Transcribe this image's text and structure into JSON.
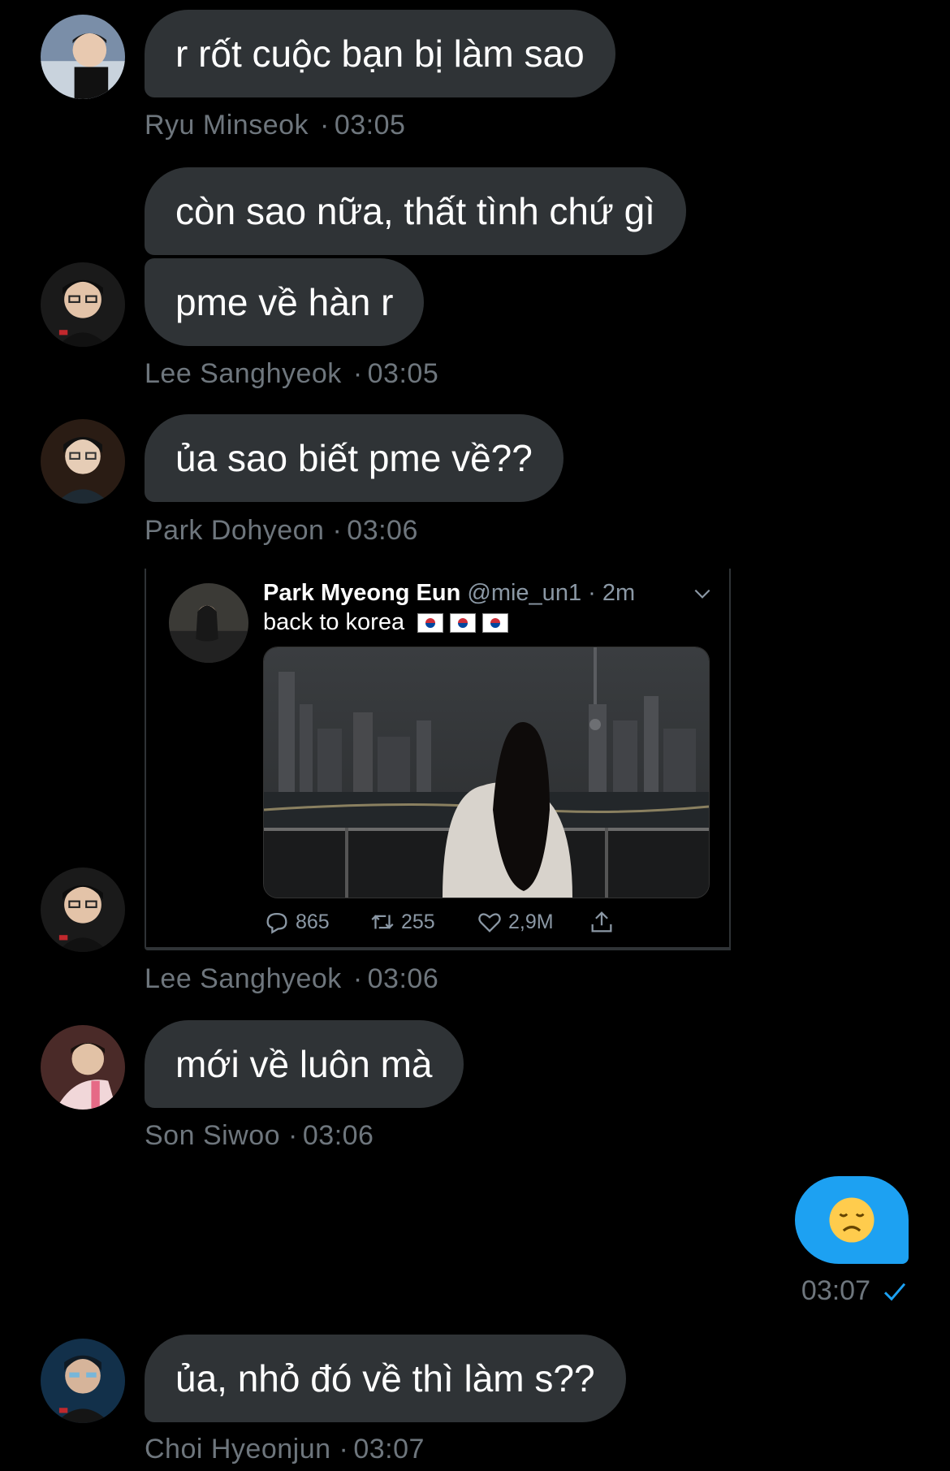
{
  "messages": [
    {
      "sender": "Ryu Minseok",
      "time": "03:05",
      "bubbles": [
        "r rốt cuộc bạn bị làm sao"
      ]
    },
    {
      "sender": "Lee Sanghyeok",
      "time": "03:05",
      "bubbles": [
        "còn sao nữa, thất tình chứ gì",
        "pme về hàn r"
      ]
    },
    {
      "sender": "Park Dohyeon",
      "time": "03:06",
      "bubbles": [
        "ủa sao biết pme về??"
      ]
    },
    {
      "sender": "Lee Sanghyeok",
      "time": "03:06",
      "shared_tweet": {
        "name": "Park Myeong Eun",
        "handle": "@mie_un1",
        "age": "2m",
        "text": "back to korea",
        "replies": "865",
        "retweets": "255",
        "likes": "2,9M"
      }
    },
    {
      "sender": "Son Siwoo",
      "time": "03:06",
      "bubbles": [
        "mới về luôn mà"
      ]
    },
    {
      "sender": "me",
      "time": "03:07",
      "emoji": "disappointed-face",
      "read": true
    },
    {
      "sender": "Choi Hyeonjun",
      "time": "03:07",
      "bubbles": [
        "ủa, nhỏ đó về thì làm s??"
      ]
    }
  ],
  "colors": {
    "background": "#000000",
    "bubble_received": "#2f3336",
    "bubble_sent": "#1da1f2",
    "meta_text": "#6e767d",
    "check": "#1da1f2"
  },
  "icons": [
    "reply-icon",
    "retweet-icon",
    "like-icon",
    "share-icon",
    "chevron-down-icon",
    "read-check-icon"
  ]
}
